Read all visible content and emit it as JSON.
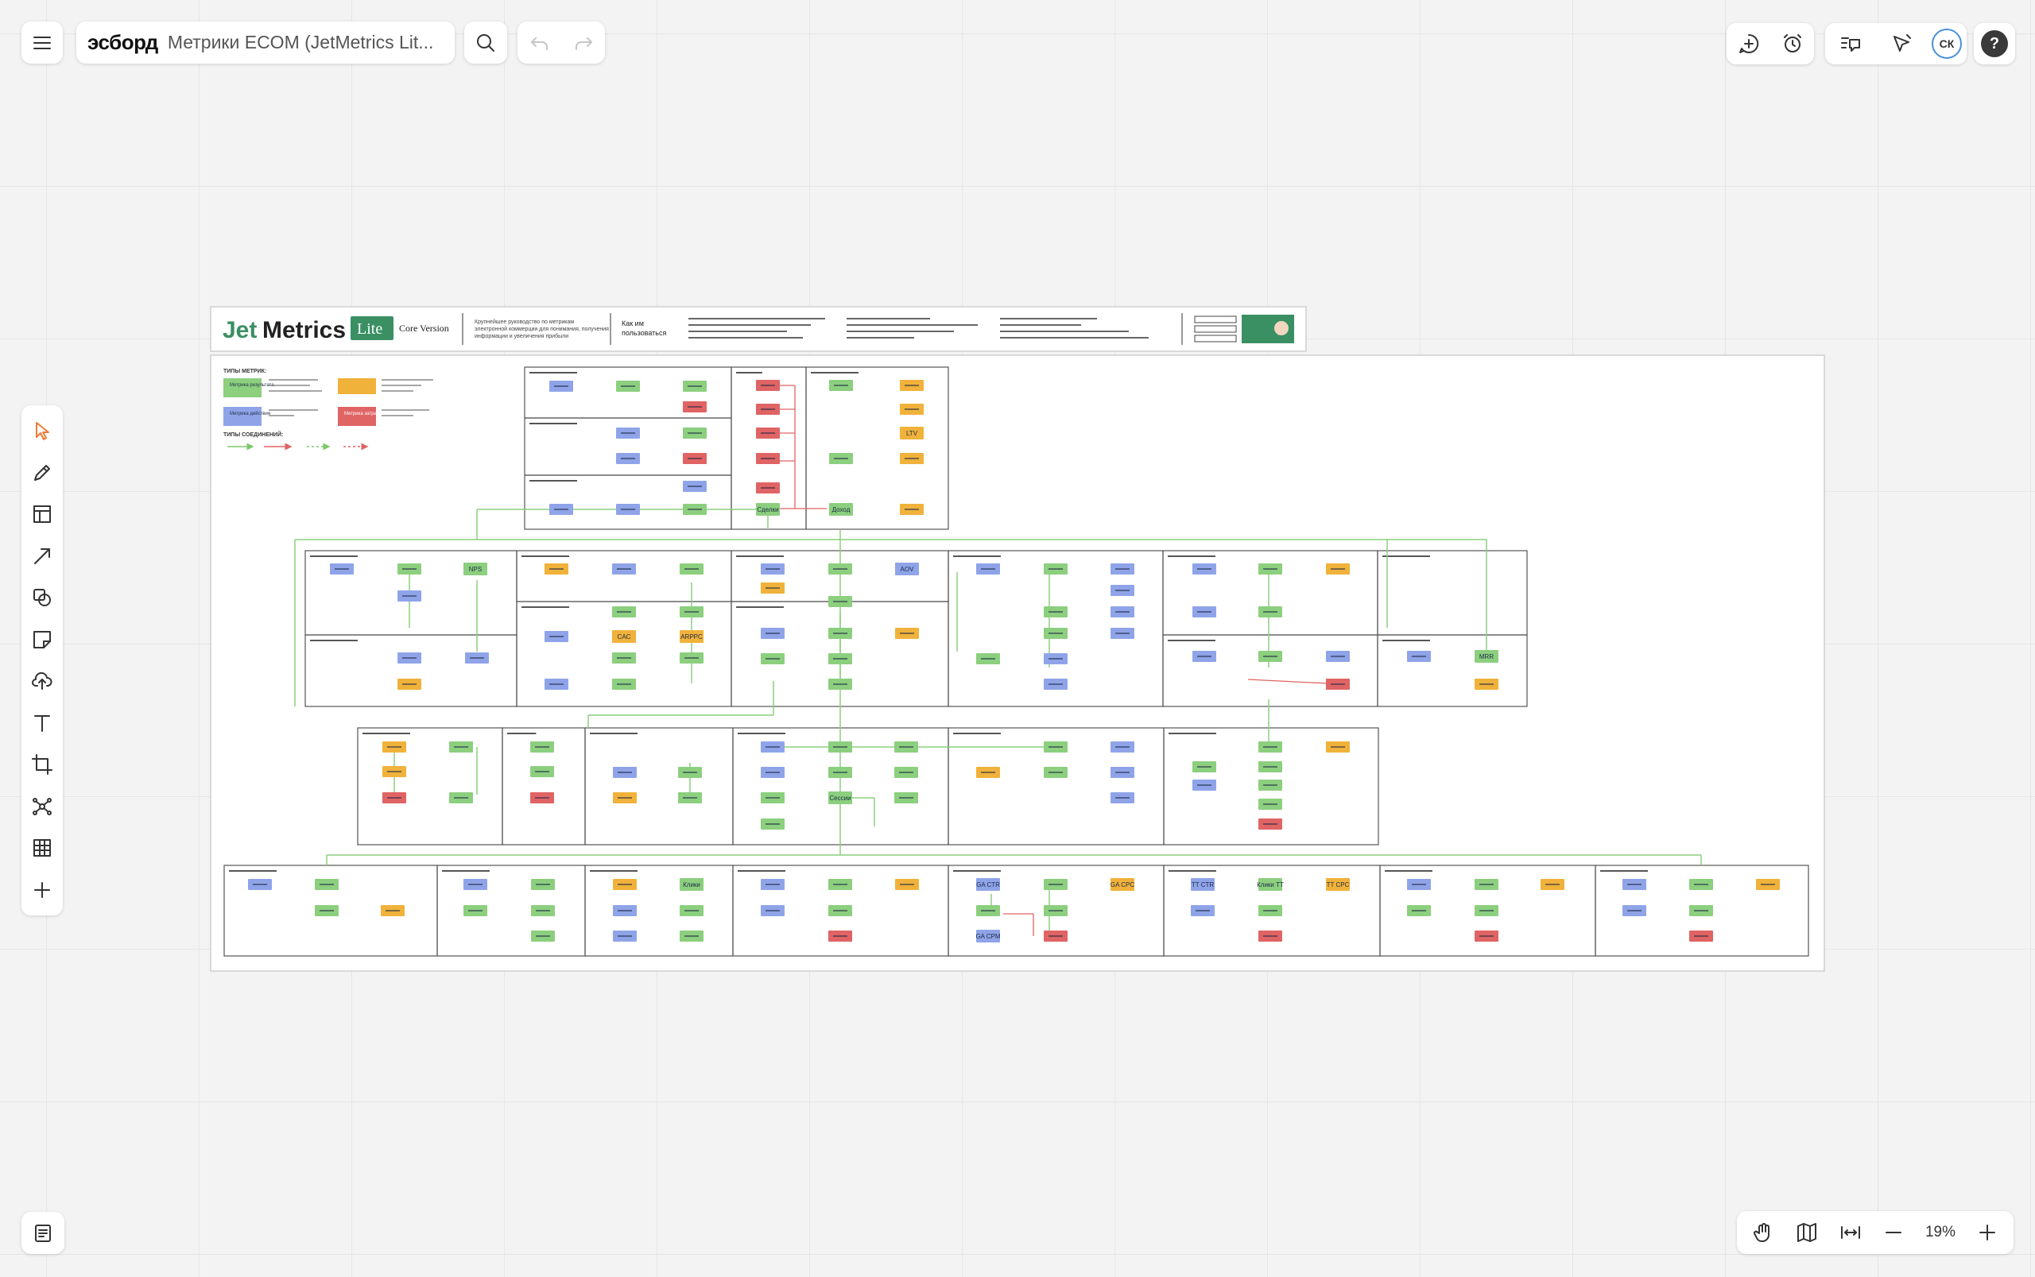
{
  "header": {
    "brand": "эсборд",
    "board_title": "Метрики ECOM (JetMetrics Lit..."
  },
  "avatar_initials": "СК",
  "zoom": {
    "value": "19%"
  },
  "board": {
    "logo_jet": "Jet",
    "logo_metrics": "Metrics",
    "lite_badge": "Lite",
    "core_version": "Core Version",
    "intro_text_1": "Крупнейшее руководство по метрикам",
    "intro_text_2": "электронной коммерции для понимания, получения",
    "intro_text_3": "информации и увеличения прибыли",
    "how_to_1": "Как им",
    "how_to_2": "пользоваться",
    "legend": {
      "metric_types_title": "ТИПЫ МЕТРИК:",
      "result_metric": "Метрика результата",
      "action_metric": "Метрика действия",
      "cost_metric": "Метрика затрат",
      "connection_types_title": "ТИПЫ СОЕДИНЕНИЙ:"
    },
    "labels": {
      "nps": "NPS",
      "aov": "AOV",
      "cac": "CAC",
      "arppc": "ARPPC",
      "ltv": "LTV",
      "mrr": "MRR",
      "sessions": "Сессии",
      "orders": "Сделки",
      "income": "Доход",
      "clicks": "Клики",
      "ga_ctr": "GA CTR",
      "ga_cpc": "GA CPC",
      "ga_cpm": "GA CPM",
      "tt_ctr": "TT CTR",
      "clicks_tt": "Клики ТТ",
      "tt_cpc": "TT CPC"
    }
  },
  "colors": {
    "result": "#8ccf7e",
    "action": "#8fa4e8",
    "cost_orange": "#f0b23a",
    "cost_red": "#e06464",
    "brand_green": "#3a8f63",
    "accent": "#f07a3a"
  }
}
